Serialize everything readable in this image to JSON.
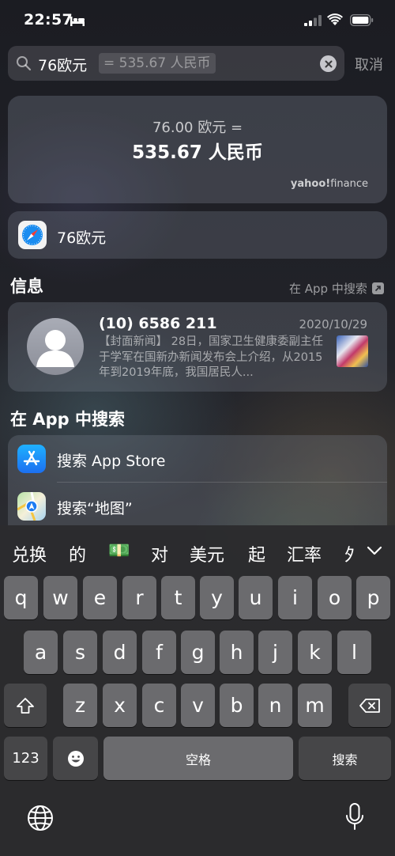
{
  "status_bar": {
    "time": "22:57"
  },
  "search": {
    "query": "76欧元",
    "completion": "= 535.67 人民币",
    "cancel_label": "取消"
  },
  "converter": {
    "from_text": "76.00 欧元 =",
    "to_text": "535.67 人民币",
    "provider": "yahoo!",
    "provider_suffix": "finance"
  },
  "safari_suggestion": {
    "label": "76欧元"
  },
  "messages_section": {
    "title": "信息",
    "search_in_app_label": "在 App 中搜索",
    "message": {
      "sender": "(10) 6586 211",
      "date": "2020/10/29",
      "preview": "【封面新闻】 28日，国家卫生健康委副主任于学军在国新办新闻发布会上介绍，从2015年到2019年底，我国居民人..."
    }
  },
  "app_search_section": {
    "title": "在 App 中搜索",
    "items": [
      {
        "label": "搜索 App Store",
        "icon": "app-store-icon"
      },
      {
        "label": "搜索“地图”",
        "icon": "maps-icon"
      }
    ]
  },
  "keyboard": {
    "candidates": [
      "兑换",
      "的",
      "💵",
      "对",
      "美元",
      "起",
      "汇率",
      "外"
    ],
    "rows": [
      [
        "q",
        "w",
        "e",
        "r",
        "t",
        "y",
        "u",
        "i",
        "o",
        "p"
      ],
      [
        "a",
        "s",
        "d",
        "f",
        "g",
        "h",
        "j",
        "k",
        "l"
      ],
      [
        "z",
        "x",
        "c",
        "v",
        "b",
        "n",
        "m"
      ]
    ],
    "numbers_key": "123",
    "space_key": "空格",
    "search_key": "搜索"
  }
}
